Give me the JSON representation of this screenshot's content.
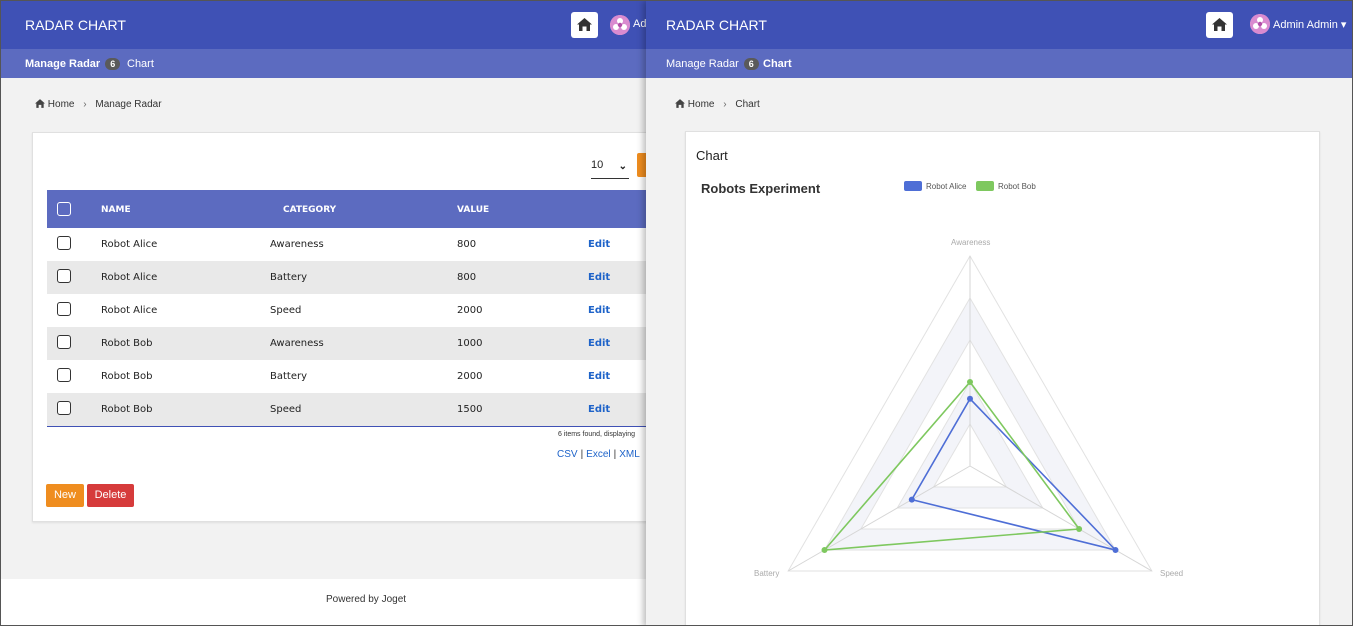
{
  "app": {
    "title": "RADAR CHART"
  },
  "left": {
    "nav": {
      "manage_radar": "Manage Radar",
      "badge": "6",
      "chart": "Chart"
    },
    "admin_truncated": "Ad",
    "breadcrumb": {
      "home": "Home",
      "current": "Manage Radar"
    },
    "page_size": "10",
    "table": {
      "headers": [
        "NAME",
        "CATEGORY",
        "VALUE"
      ],
      "rows": [
        {
          "name": "Robot Alice",
          "category": "Awareness",
          "value": "800",
          "action": "Edit"
        },
        {
          "name": "Robot Alice",
          "category": "Battery",
          "value": "800",
          "action": "Edit"
        },
        {
          "name": "Robot Alice",
          "category": "Speed",
          "value": "2000",
          "action": "Edit"
        },
        {
          "name": "Robot Bob",
          "category": "Awareness",
          "value": "1000",
          "action": "Edit"
        },
        {
          "name": "Robot Bob",
          "category": "Battery",
          "value": "2000",
          "action": "Edit"
        },
        {
          "name": "Robot Bob",
          "category": "Speed",
          "value": "1500",
          "action": "Edit"
        }
      ]
    },
    "found_text": "6 items found, displaying",
    "exports": {
      "csv": "CSV",
      "excel": "Excel",
      "xml": "XML"
    },
    "buttons": {
      "new": "New",
      "delete": "Delete"
    },
    "footer": "Powered by Joget"
  },
  "right": {
    "admin_name": "Admin Admin",
    "nav": {
      "manage_radar": "Manage Radar",
      "badge": "6",
      "chart": "Chart"
    },
    "breadcrumb": {
      "home": "Home",
      "current": "Chart"
    },
    "panel_title": "Chart"
  },
  "colors": {
    "header": "#3f51b5",
    "subheader": "#5c6bc0",
    "orange": "#ef8d1f",
    "red": "#d63b3b",
    "link": "#1e63c9",
    "alice": "#4e6ed6",
    "bob": "#7ec85f"
  },
  "icons": [
    "home-icon",
    "avatar-icon",
    "caret-down-icon",
    "checkbox-icon"
  ],
  "chart_data": {
    "type": "radar",
    "title": "Robots Experiment",
    "categories": [
      "Awareness",
      "Speed",
      "Battery"
    ],
    "series": [
      {
        "name": "Robot Alice",
        "values": [
          800,
          2000,
          800
        ],
        "color": "#4e6ed6"
      },
      {
        "name": "Robot Bob",
        "values": [
          1000,
          1500,
          2000
        ],
        "color": "#7ec85f"
      }
    ],
    "rmax": 2500,
    "legend": "top"
  }
}
